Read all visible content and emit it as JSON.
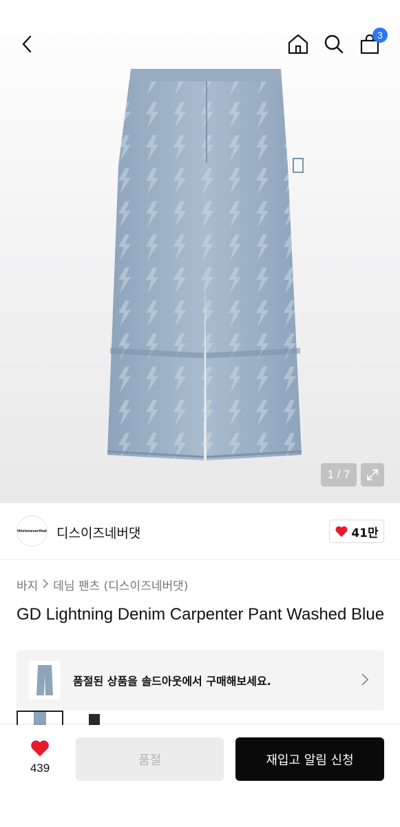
{
  "header": {
    "cart_count": "3"
  },
  "gallery": {
    "counter": "1 / 7"
  },
  "brand": {
    "logo_text": "thisisneverthat",
    "name": "디스이즈네버댓",
    "likes": "41만"
  },
  "breadcrumb": {
    "category": "바지",
    "subcategory": "데님 팬츠 (디스이즈네버댓)"
  },
  "product": {
    "title": "GD Lightning Denim Carpenter Pant Washed Blue"
  },
  "soldout_banner": {
    "text": "품절된 상품을 솔드아웃에서 구매해보세요."
  },
  "bottom_bar": {
    "wish_count": "439",
    "soldout_label": "품절",
    "restock_label": "재입고 알림 신청"
  },
  "colors": {
    "accent_badge": "#2f74f5",
    "heart": "#e8192c",
    "primary_button": "#0a0a0a",
    "denim": "#9fb3c7"
  }
}
